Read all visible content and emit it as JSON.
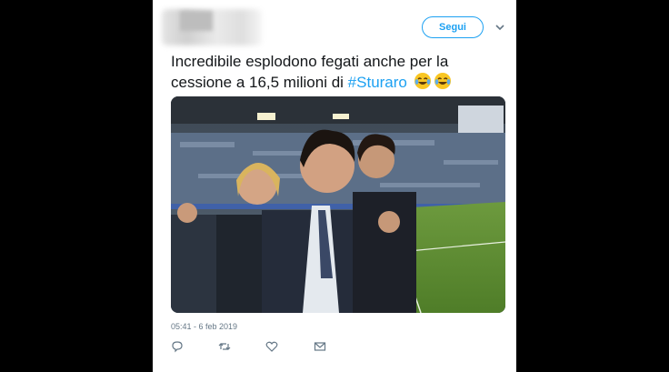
{
  "header": {
    "follow_label": "Segui"
  },
  "tweet": {
    "text_main": "Incredibile esplodono fegati anche per la cessione a 16,5 milioni di ",
    "hashtag": "#Sturaro",
    "timestamp": "05:41 - 6 feb 2019"
  },
  "icons": {
    "reply": "reply-icon",
    "retweet": "retweet-icon",
    "like": "heart-icon",
    "message": "message-icon",
    "menu": "chevron-down-icon",
    "emoji": "tears-of-joy-emoji"
  },
  "colors": {
    "accent": "#1da1f2",
    "text": "#14171a",
    "muted": "#657786",
    "background": "#000000"
  }
}
